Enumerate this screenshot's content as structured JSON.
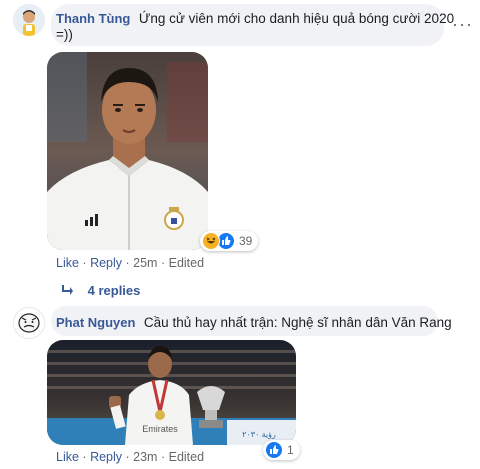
{
  "comments": [
    {
      "author": "Thanh Tùng",
      "text_line1": "Ứng cử viên mới cho danh hiệu quả bóng cười 2020",
      "text_line2": "=))",
      "actions": {
        "like": "Like",
        "reply": "Reply",
        "time": "25m",
        "edited": "Edited"
      },
      "reaction_count": "39",
      "replies_label": "4 replies"
    },
    {
      "author": "Phat Nguyen",
      "text": "Cầu thủ hay nhất trận: Nghệ sĩ nhân dân Văn Rang",
      "actions": {
        "like": "Like",
        "reply": "Reply",
        "time": "23m",
        "edited": "Edited"
      },
      "reaction_count": "1"
    }
  ],
  "photo2_banner": "Emirates",
  "more_icon": "more-horizontal-icon",
  "colors": {
    "link": "#385898",
    "bubble": "#f0f2f5",
    "meta": "#65676b",
    "like_blue": "#1877f2",
    "haha_yellow": "#f7b125"
  }
}
